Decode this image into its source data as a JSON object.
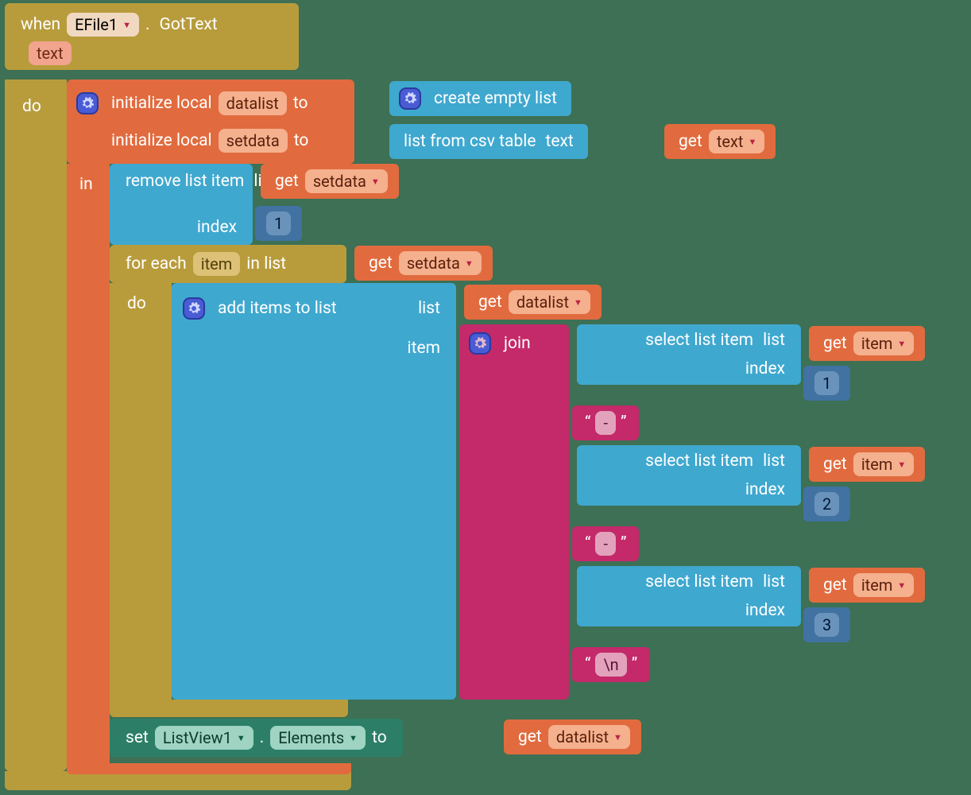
{
  "colors": {
    "mustard": "#b89c3c",
    "orange": "#e16b3e",
    "cyan": "#3fa8cf",
    "magenta": "#c4296a",
    "green": "#2c7f66",
    "navy": "#4172a2",
    "background": "#3d7054"
  },
  "event": {
    "when": "when",
    "component": "EFile1",
    "dot": ".",
    "method": "GotText",
    "param": "text",
    "do": "do"
  },
  "init": {
    "row1_prefix": "initialize local",
    "row1_var": "datalist",
    "row1_to": "to",
    "row2_prefix": "initialize local",
    "row2_var": "setdata",
    "row2_to": "to",
    "create_empty": "create empty list",
    "csv_label": "list from csv table",
    "csv_arg": "text",
    "get": "get",
    "get_var": "text",
    "in": "in"
  },
  "remove": {
    "line1a": "remove list item",
    "line1b": "list",
    "line2": "index",
    "get": "get",
    "get_var": "setdata",
    "index_val": "1"
  },
  "foreach": {
    "for_each": "for each",
    "item": "item",
    "in_list": "in list",
    "get": "get",
    "get_var": "setdata",
    "do": "do"
  },
  "addlist": {
    "label": "add items to list",
    "list": "list",
    "item": "item",
    "get": "get",
    "get_var": "datalist"
  },
  "join": {
    "label": "join",
    "rows": [
      {
        "kind": "select",
        "sel": "select list item",
        "list": "list",
        "idxlab": "index",
        "get": "get",
        "getvar": "item",
        "index": "1"
      },
      {
        "kind": "string",
        "value": "-"
      },
      {
        "kind": "select",
        "sel": "select list item",
        "list": "list",
        "idxlab": "index",
        "get": "get",
        "getvar": "item",
        "index": "2"
      },
      {
        "kind": "string",
        "value": "-"
      },
      {
        "kind": "select",
        "sel": "select list item",
        "list": "list",
        "idxlab": "index",
        "get": "get",
        "getvar": "item",
        "index": "3"
      },
      {
        "kind": "string",
        "value": "\\n"
      }
    ]
  },
  "setlv": {
    "set": "set",
    "comp": "ListView1",
    "dot": ".",
    "prop": "Elements",
    "to": "to",
    "get": "get",
    "get_var": "datalist"
  }
}
